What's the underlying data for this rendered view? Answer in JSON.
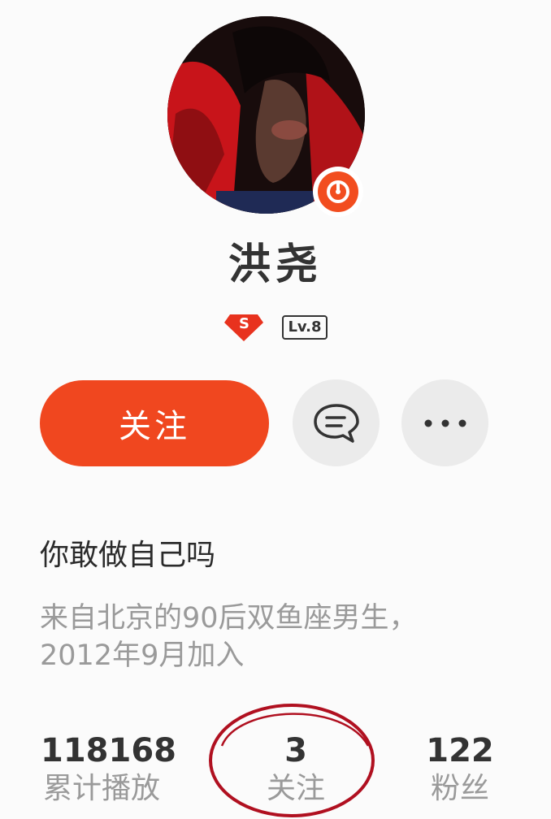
{
  "profile": {
    "name": "洪尧",
    "level": "Lv.8",
    "verified_badge": "S",
    "slogan": "你敢做自己吗",
    "bio_line1": "来自北京的90后双鱼座男生，",
    "bio_line2": "2012年9月加入"
  },
  "actions": {
    "follow_label": "关注",
    "message_icon": "chat-bubble-icon",
    "more_icon": "more-dots-icon"
  },
  "stats": [
    {
      "value": "118168",
      "label": "累计播放"
    },
    {
      "value": "3",
      "label": "关注"
    },
    {
      "value": "122",
      "label": "粉丝"
    }
  ],
  "colors": {
    "accent": "#f0471f",
    "badge_red": "#e8321e",
    "annotation_circle": "#b01020"
  }
}
